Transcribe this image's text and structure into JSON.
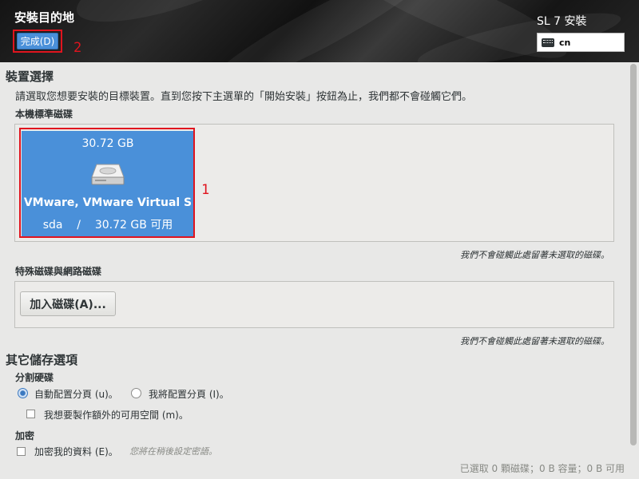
{
  "header": {
    "title": "安裝目的地",
    "done_label": "完成(D)",
    "product": "SL 7 安裝",
    "keyboard_layout": "cn",
    "annotation_2": "2"
  },
  "device_selection": {
    "heading": "裝置選擇",
    "description": "請選取您想要安裝的目標裝置。直到您按下主選單的「開始安裝」按鈕為止，我們都不會碰觸它們。",
    "local_disks_heading": "本機標準磁碟",
    "disk": {
      "size": "30.72 GB",
      "name": "VMware, VMware Virtual S",
      "device": "sda",
      "separator": "/",
      "free": "30.72 GB 可用",
      "icon": "hard-disk-icon"
    },
    "annotation_1": "1",
    "local_note": "我們不會碰觸此處留著未選取的磁碟。",
    "special_heading": "特殊磁碟與網路磁碟",
    "add_disk_label": "加入磁碟(A)...",
    "special_note": "我們不會碰觸此處留著未選取的磁碟。"
  },
  "other_storage": {
    "heading": "其它儲存選項",
    "partitioning_heading": "分割硬碟",
    "auto_label": "自動配置分頁 (u)。",
    "manual_label": "我將配置分頁 (I)。",
    "extra_space_label": "我想要製作額外的可用空間 (m)。",
    "encryption_heading": "加密",
    "encrypt_label": "加密我的資料 (E)。",
    "encrypt_hint": "您將在稍後設定密語。"
  },
  "status_bar": {
    "summary": "已選取 0 顆磁碟；0 B 容量；0 B 可用"
  },
  "colors": {
    "accent": "#4a90d9",
    "highlight": "#e0141e"
  }
}
